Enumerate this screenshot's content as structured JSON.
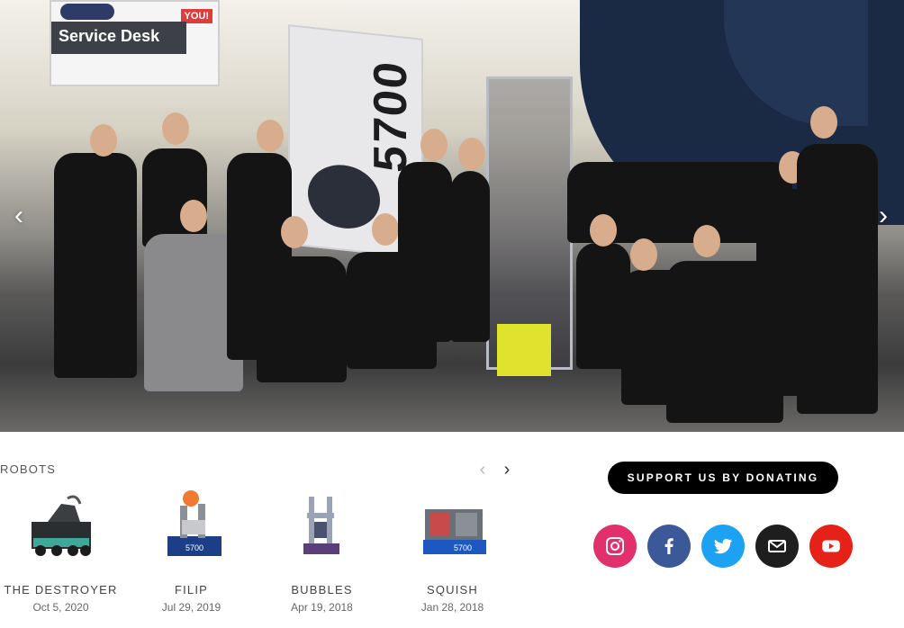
{
  "hero": {
    "sign_text": "Service Desk",
    "sign_badge": "YOU!",
    "flag_number": "5700",
    "prev_arrow": "‹",
    "next_arrow": "›"
  },
  "robots": {
    "title": "ROBOTS",
    "prev_icon": "‹",
    "next_icon": "›",
    "items": [
      {
        "name": "THE DESTROYER",
        "date": "Oct 5, 2020"
      },
      {
        "name": "FILIP",
        "date": "Jul 29, 2019"
      },
      {
        "name": "BUBBLES",
        "date": "Apr 19, 2018"
      },
      {
        "name": "SQUISH",
        "date": "Jan 28, 2018"
      }
    ]
  },
  "donate": {
    "label": "SUPPORT US BY DONATING"
  },
  "social": [
    {
      "icon": "instagram-icon",
      "color": "#e1306c"
    },
    {
      "icon": "facebook-icon",
      "color": "#3b5998"
    },
    {
      "icon": "twitter-icon",
      "color": "#1da1f2"
    },
    {
      "icon": "email-icon",
      "color": "#1e1e1e"
    },
    {
      "icon": "youtube-icon",
      "color": "#e62117"
    }
  ]
}
